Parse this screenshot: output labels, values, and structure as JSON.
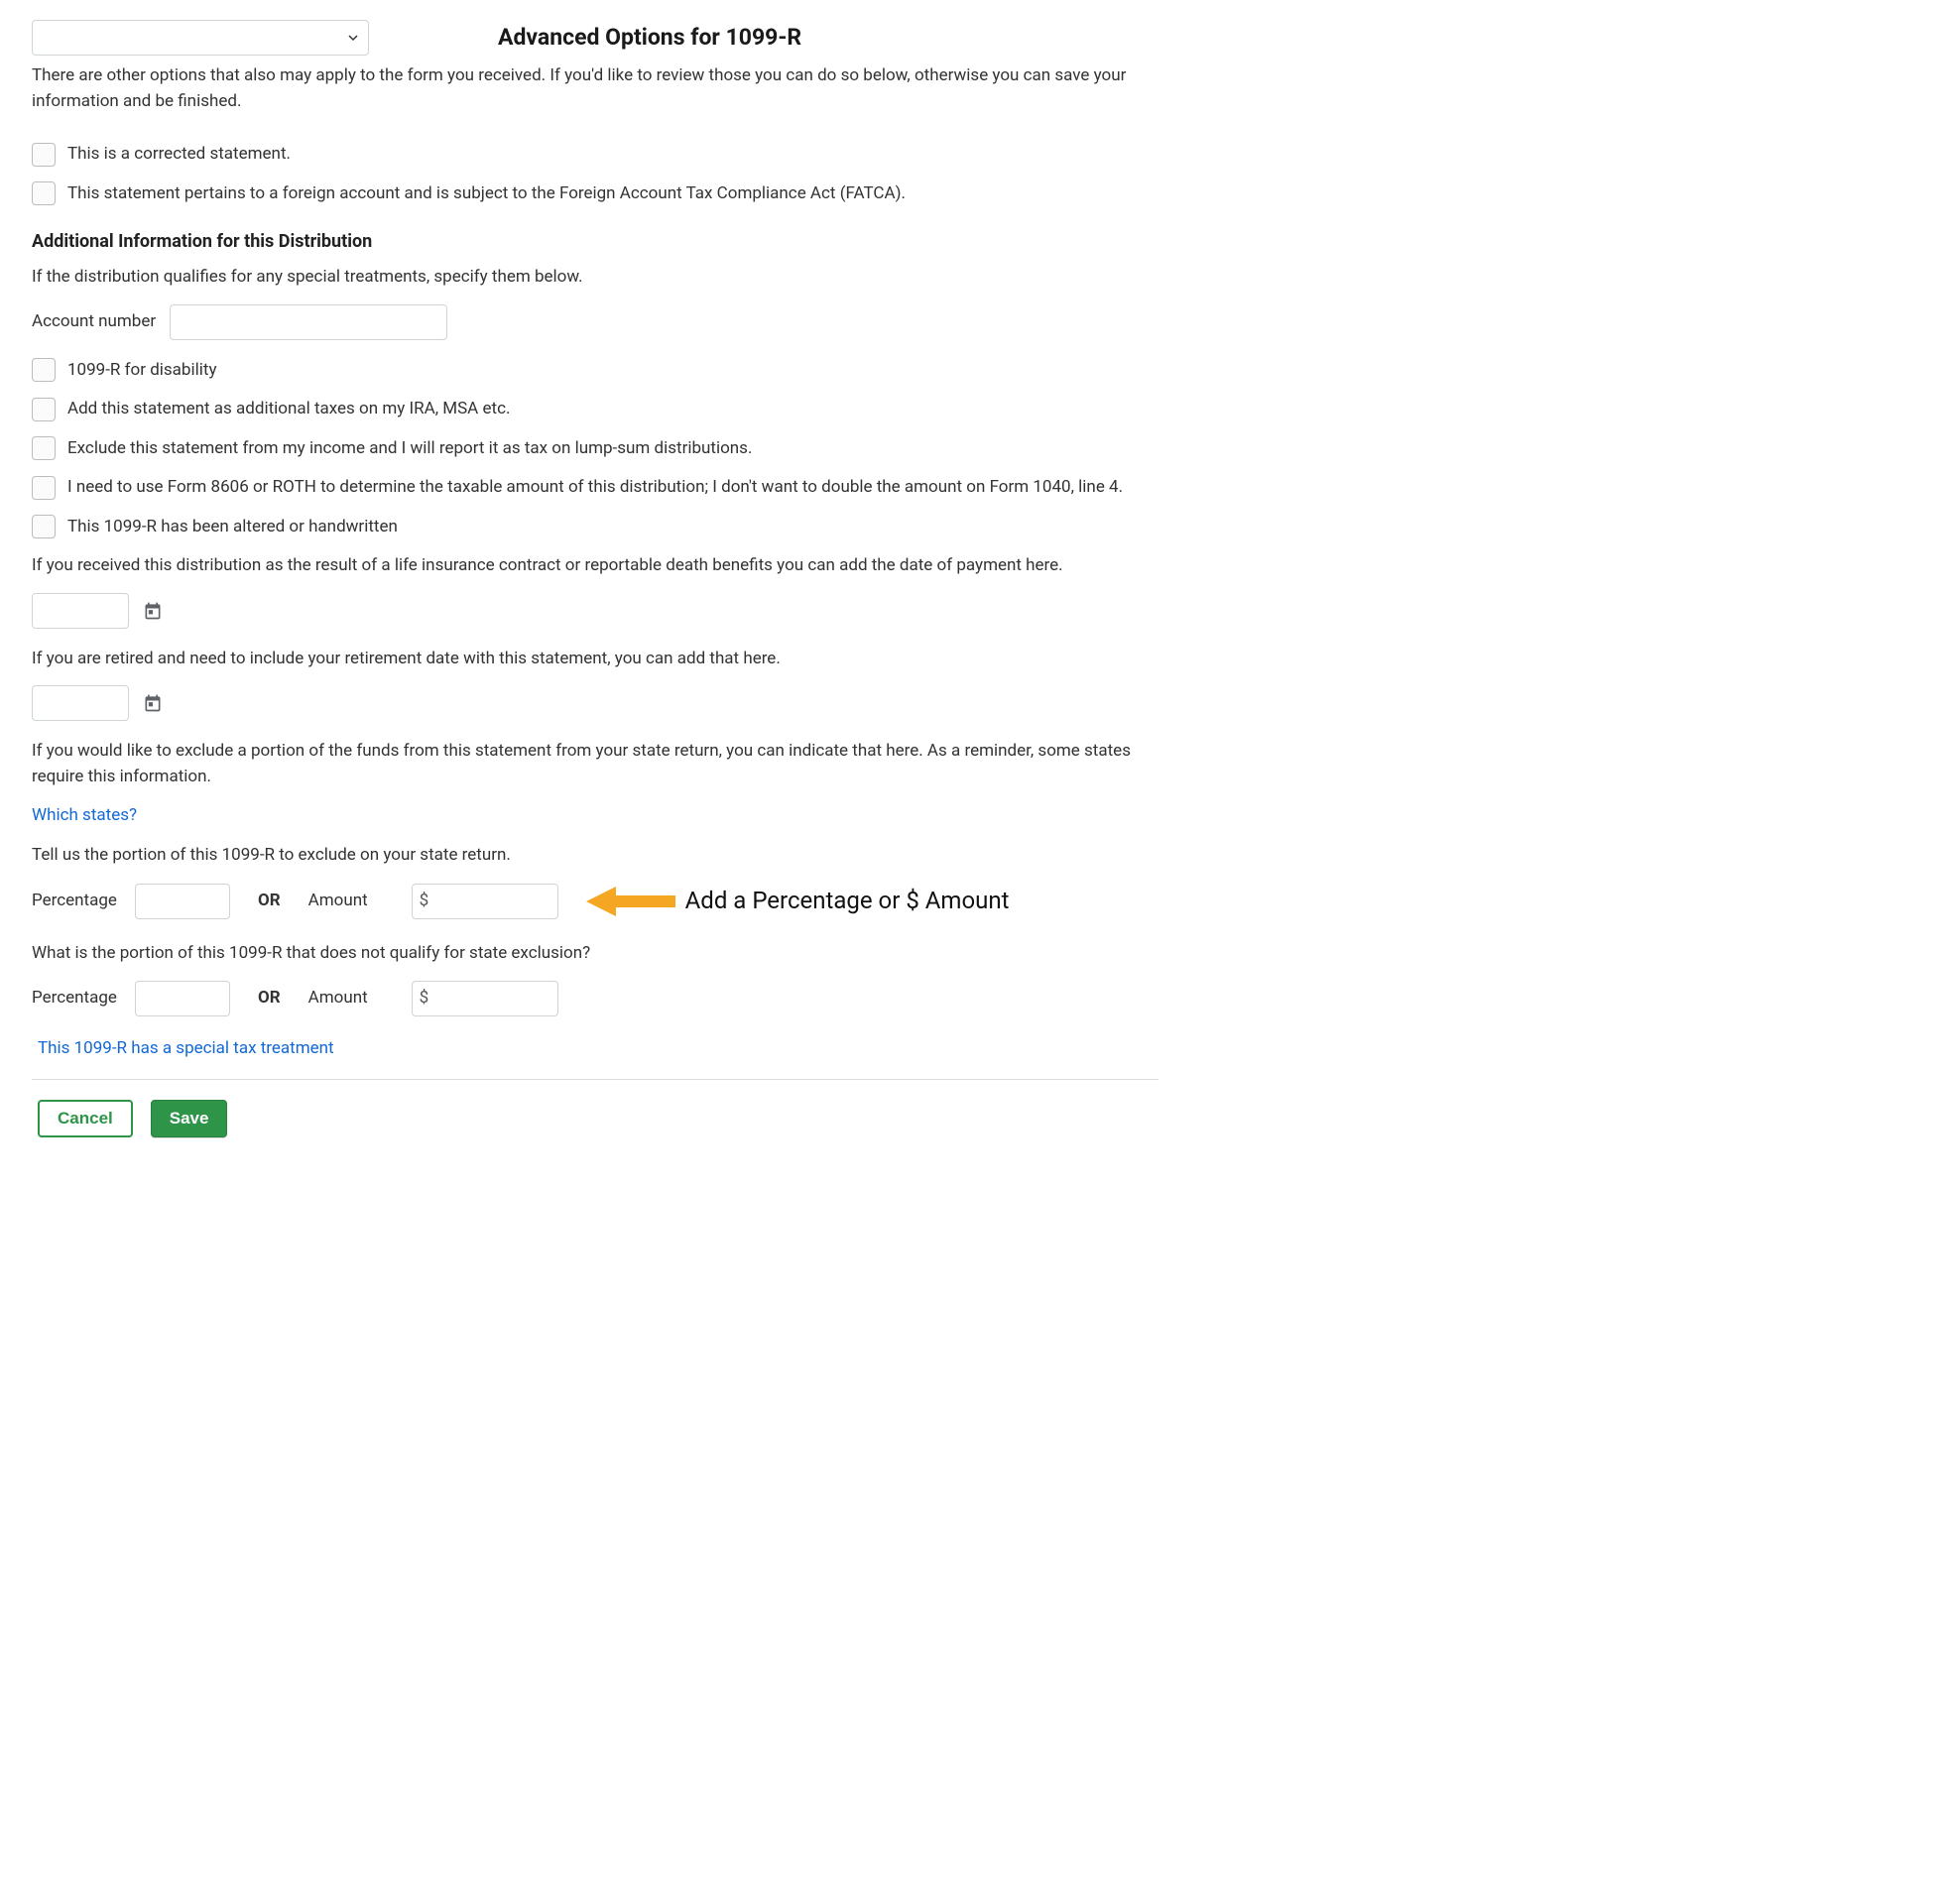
{
  "header": {
    "title": "Advanced Options for 1099-R",
    "intro": "There are other options that also may apply to the form you received. If you'd like to review those you can do so below, otherwise you can save your information and be finished."
  },
  "checkboxes": {
    "corrected": "This is a corrected statement.",
    "fatca": "This statement pertains to a foreign account and is subject to the Foreign Account Tax Compliance Act (FATCA)."
  },
  "additional": {
    "heading": "Additional Information for this Distribution",
    "desc": "If the distribution qualifies for any special treatments, specify them below.",
    "account_label": "Account number"
  },
  "opts": {
    "disability": "1099-R for disability",
    "addl_taxes": "Add this statement as additional taxes on my IRA, MSA etc.",
    "exclude_income": "Exclude this statement from my income and I will report it as tax on lump-sum distributions.",
    "form8606": "I need to use Form 8606 or ROTH to determine the taxable amount of this distribution; I don't want to double the amount on Form 1040, line 4.",
    "altered": "This 1099-R has been altered or handwritten"
  },
  "dates": {
    "life_ins": "If you received this distribution as the result of a life insurance contract or reportable death benefits you can add the date of payment here.",
    "retirement": "If you are retired and need to include your retirement date with this statement, you can add that here."
  },
  "state": {
    "exclude_intro": "If you would like to exclude a portion of the funds from this statement from your state return, you can indicate that here. As a reminder, some states require this information.",
    "which_states": "Which states?",
    "tell_us": "Tell us the portion of this 1099-R to exclude on your state return.",
    "not_qualify": "What is the portion of this 1099-R that does not qualify for state exclusion?",
    "percentage_label": "Percentage",
    "or": "OR",
    "amount_label": "Amount",
    "dollar": "$"
  },
  "annotation": {
    "text": "Add a Percentage or $ Amount"
  },
  "special_link": "This 1099-R has a special tax treatment",
  "buttons": {
    "cancel": "Cancel",
    "save": "Save"
  }
}
